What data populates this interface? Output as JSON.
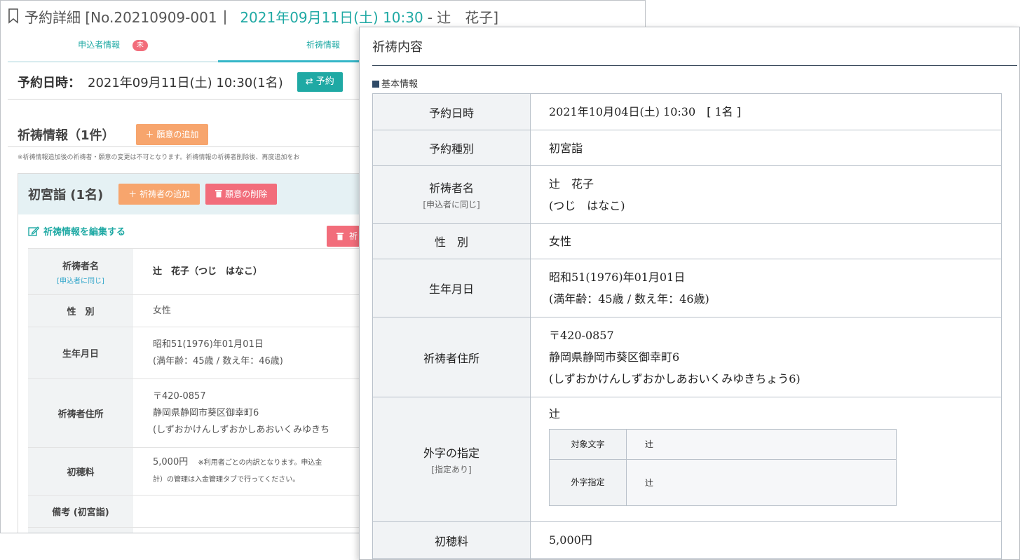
{
  "back_window": {
    "title_prefix": "予約詳細 [No.20210909-001",
    "title_sep": "|",
    "title_date": "2021年09月11日(土) 10:30",
    "title_suffix": "- 辻　花子]",
    "tabs": [
      {
        "label": "申込者情報",
        "badge": "未"
      },
      {
        "label": "祈祷情報"
      }
    ],
    "reserve_label": "予約日時：",
    "reserve_value": "2021年09月11日(土) 10:30(1名)",
    "change_button": "⇄ 予約",
    "kito_title": "祈祷情報（1件）",
    "add_wish_button": "＋ 願意の追加",
    "note": "※祈祷情報追加後の祈祷者・願意の変更は不可となります。祈祷情報の祈祷者削除後、再度追加をお",
    "hatsu_title": "初宮詣 (1名)",
    "add_person_button": "＋ 祈祷者の追加",
    "delete_wish_button": "願意の削除",
    "edit_link": "祈祷情報を編集する",
    "delete_mini_button": "祈",
    "rows": [
      {
        "label": "祈祷者名",
        "sub": "[申込者に同じ]",
        "value": [
          "辻　花子（つじ　はなこ）"
        ]
      },
      {
        "label": "性　別",
        "value": [
          "女性"
        ]
      },
      {
        "label": "生年月日",
        "value": [
          "昭和51(1976)年01月01日",
          "(満年齢：45歳 / 数え年：46歳)"
        ]
      },
      {
        "label": "祈祷者住所",
        "value": [
          "〒420-0857",
          "静岡県静岡市葵区御幸町6",
          "(しずおかけんしずおかしあおいくみゆきち"
        ]
      },
      {
        "label": "初穂料",
        "value": [
          "5,000円"
        ],
        "note": [
          "※利用者ごとの内訳となります。申込金",
          "計）の管理は入金管理タブで行ってください。"
        ]
      },
      {
        "label": "備考 (初宮詣)",
        "value": [
          ""
        ]
      }
    ]
  },
  "front_window": {
    "title": "祈祷内容",
    "section": "基本情報",
    "rows": [
      {
        "label": "予約日時",
        "value": [
          "2021年10月04日(土) 10:30　[ 1名 ]"
        ]
      },
      {
        "label": "予約種別",
        "value": [
          "初宮詣"
        ]
      },
      {
        "label": "祈祷者名",
        "sub": "[申込者に同じ]",
        "value": [
          "辻　花子",
          "(つじ　はなこ)"
        ]
      },
      {
        "label": "性　別",
        "value": [
          "女性"
        ]
      },
      {
        "label": "生年月日",
        "value": [
          "昭和51(1976)年01月01日",
          "(満年齢：45歳 / 数え年：46歳)"
        ]
      },
      {
        "label": "祈祷者住所",
        "value": [
          "〒420-0857",
          "静岡県静岡市葵区御幸町6",
          "(しずおかけんしずおかしあおいくみゆきちょう6)"
        ]
      },
      {
        "label": "外字の指定",
        "sub": "[指定あり]",
        "value": [
          "辻"
        ]
      },
      {
        "label": "初穂料",
        "value": [
          "5,000円"
        ]
      }
    ],
    "gaiji": {
      "target_label": "対象文字",
      "target_value": "辻",
      "spec_label": "外字指定",
      "spec_value": "辻"
    }
  },
  "colors": {
    "teal": "#1fa9a4",
    "orange": "#f7a56d",
    "red": "#f26d7b",
    "navy": "#2f4a67"
  }
}
